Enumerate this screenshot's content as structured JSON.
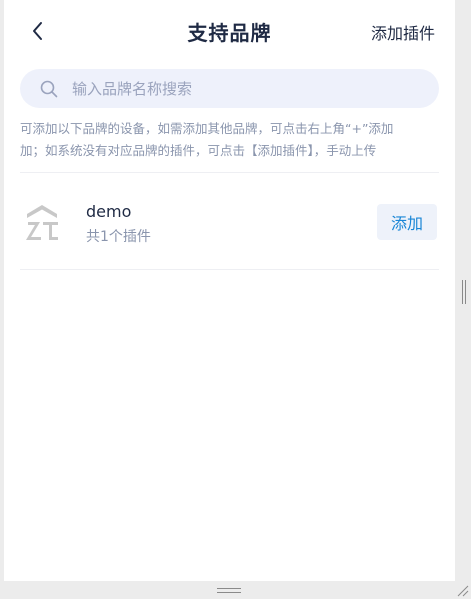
{
  "header": {
    "title": "支持品牌",
    "add_plugin_label": "添加插件"
  },
  "search": {
    "placeholder": "输入品牌名称搜索",
    "value": ""
  },
  "notice": {
    "line1": "可添加以下品牌的设备，如需添加其他品牌，可点击右上角“+”添加",
    "line2": "加；如系统没有对应品牌的插件，可点击【添加插件】，手动上传"
  },
  "brands": [
    {
      "name": "demo",
      "count_text": "共1个插件",
      "add_label": "添加",
      "logo": "zt-logo-icon"
    }
  ],
  "colors": {
    "title": "#1f2a44",
    "muted": "#8a95ad",
    "search_bg": "#eef1fb",
    "accent": "#1a86d6",
    "button_bg": "#eef2fa"
  }
}
